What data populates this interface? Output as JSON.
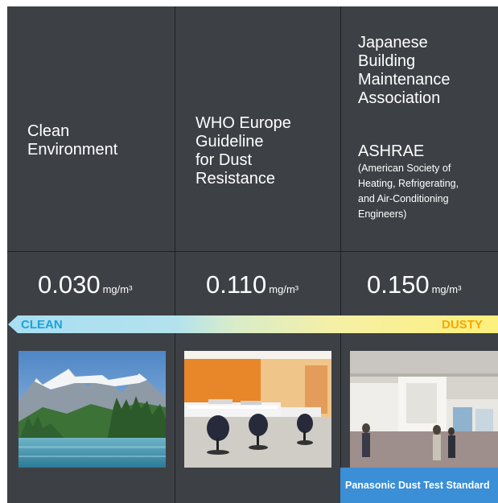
{
  "columns": [
    {
      "heading": "Clean\nEnvironment",
      "value": "0.030",
      "unit": "mg/m³"
    },
    {
      "heading": "WHO Europe\nGuideline\nfor Dust\nResistance",
      "value": "0.110",
      "unit": "mg/m³"
    },
    {
      "heading": "Japanese\nBuilding\nMaintenance\nAssociation",
      "heading2": "ASHRAE",
      "note": "(American Society of\nHeating, Refrigerating,\nand Air-Conditioning\nEngineers)",
      "value": "0.150",
      "unit": "mg/m³"
    }
  ],
  "scale": {
    "left_label": "CLEAN",
    "right_label": "DUSTY",
    "left_color": "#1aa4d8",
    "right_color": "#f5a800"
  },
  "badge": {
    "label": "Panasonic Dust Test Standard",
    "color": "#3b8fd6"
  },
  "photos": [
    "mountain-lake-photo",
    "office-photo",
    "exhibition-hall-photo"
  ]
}
